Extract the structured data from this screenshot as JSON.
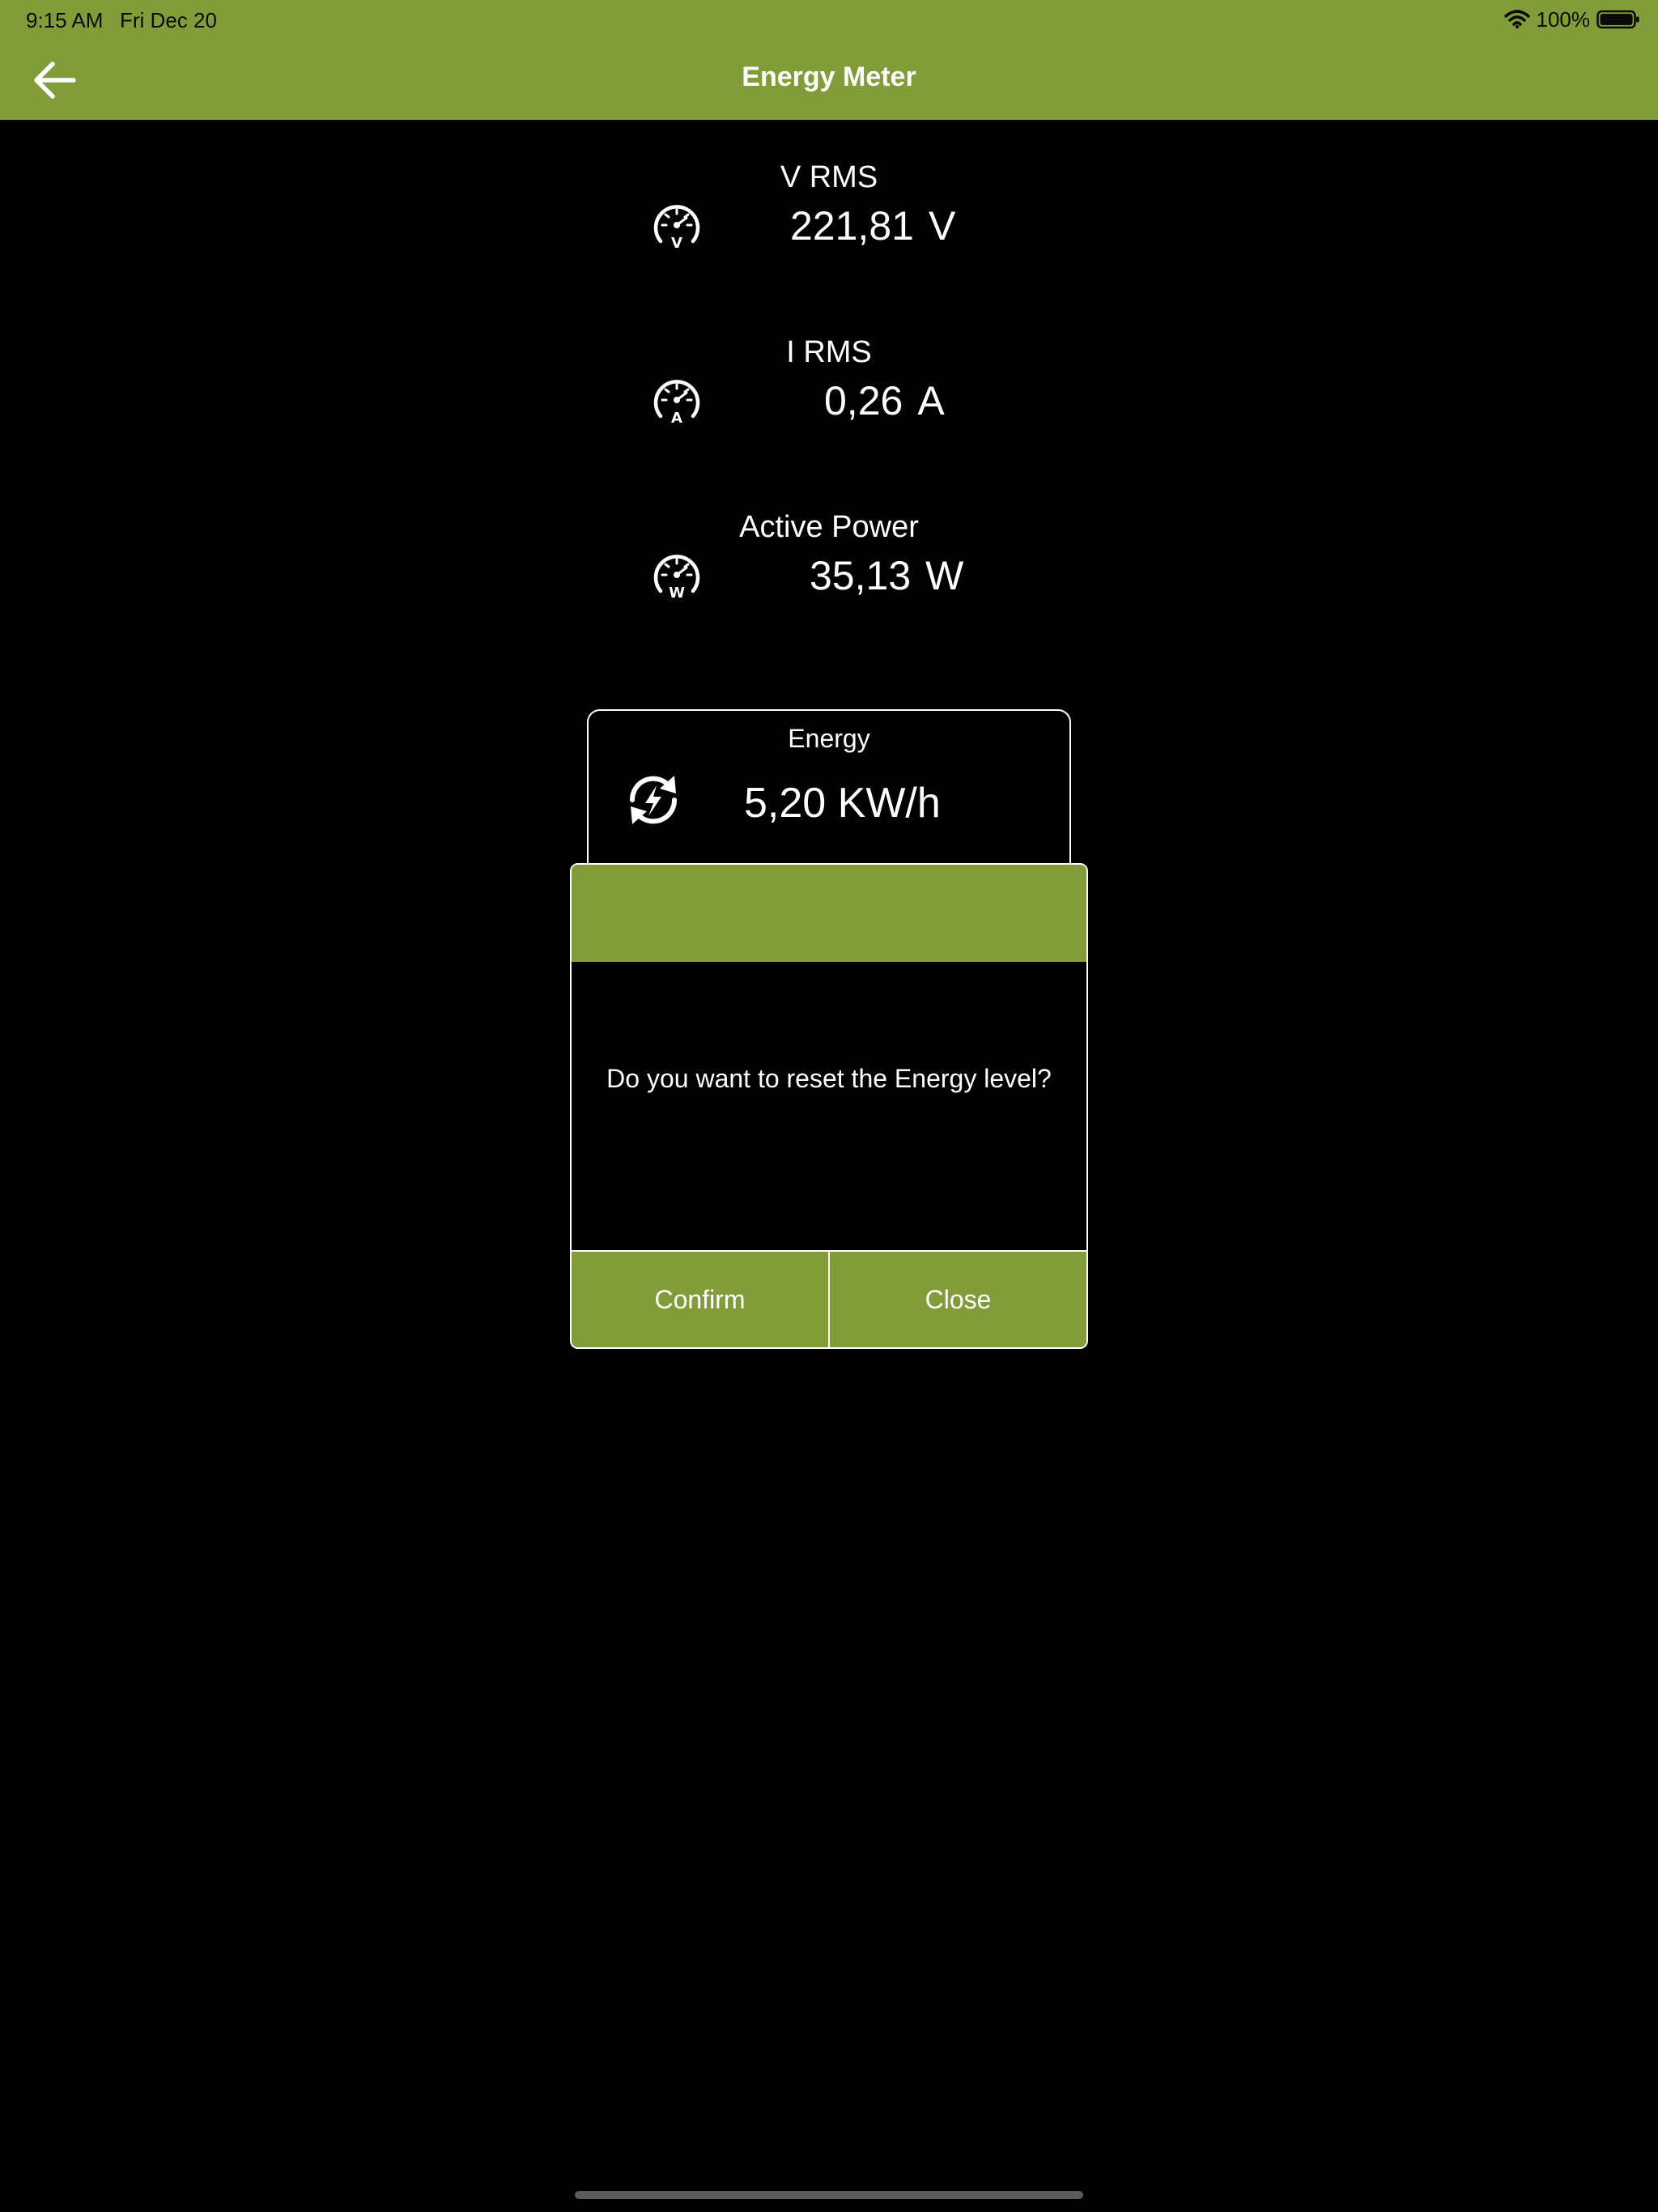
{
  "colors": {
    "accent": "#839c3a",
    "background": "#000000",
    "text": "#ffffff"
  },
  "status_bar": {
    "time": "9:15 AM",
    "date": "Fri Dec 20",
    "battery": "100%"
  },
  "nav": {
    "title": "Energy Meter",
    "back_icon": "arrow-left-icon"
  },
  "readings": [
    {
      "label": "V RMS",
      "value": "221,81",
      "unit": "V",
      "icon_letter": "V",
      "icon": "voltmeter-gauge-icon"
    },
    {
      "label": "I RMS",
      "value": "0,26",
      "unit": "A",
      "icon_letter": "A",
      "icon": "ammeter-gauge-icon"
    },
    {
      "label": "Active Power",
      "value": "35,13",
      "unit": "W",
      "icon_letter": "W",
      "icon": "wattmeter-gauge-icon"
    }
  ],
  "energy": {
    "label": "Energy",
    "value": "5,20 KW/h",
    "icon": "reset-energy-icon"
  },
  "dialog": {
    "message": "Do you want to reset the Energy level?",
    "confirm_label": "Confirm",
    "close_label": "Close"
  }
}
